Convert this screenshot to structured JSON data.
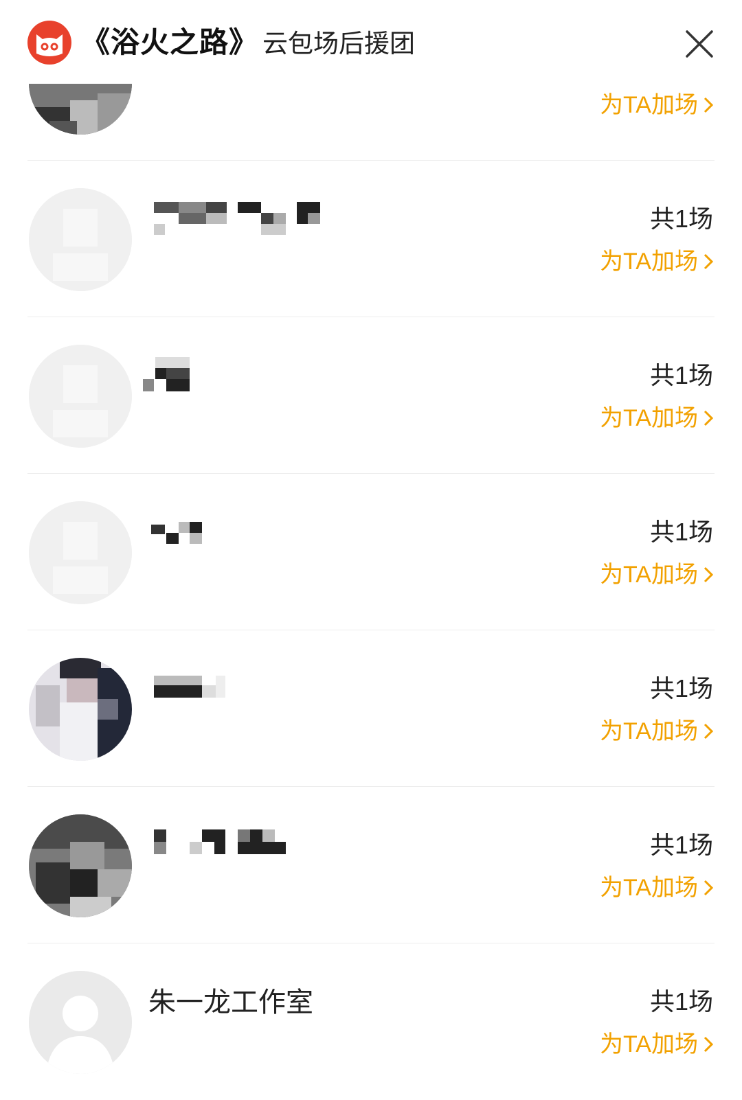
{
  "header": {
    "film_title": "《浴火之路》",
    "subtitle": "云包场后援团",
    "logo_icon": "maoyan-cat-logo",
    "close_icon": "close-icon"
  },
  "colors": {
    "accent": "#f2a100",
    "logo_red": "#e8412c",
    "text": "#222222",
    "divider": "#ececec"
  },
  "rows": [
    {
      "name": "",
      "count": "",
      "support_label": "为TA加场"
    },
    {
      "name": "",
      "count": "共1场",
      "support_label": "为TA加场"
    },
    {
      "name": "",
      "count": "共1场",
      "support_label": "为TA加场"
    },
    {
      "name": "",
      "count": "共1场",
      "support_label": "为TA加场"
    },
    {
      "name": "",
      "count": "共1场",
      "support_label": "为TA加场"
    },
    {
      "name": "",
      "count": "共1场",
      "support_label": "为TA加场"
    },
    {
      "name": "朱一龙工作室",
      "count": "共1场",
      "support_label": "为TA加场"
    }
  ]
}
